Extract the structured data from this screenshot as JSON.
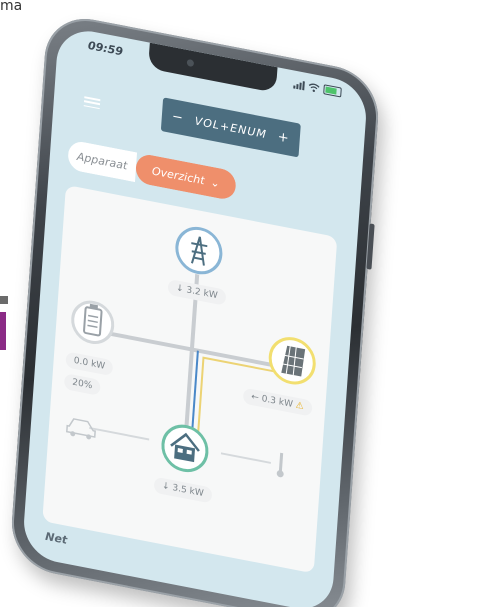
{
  "page": {
    "corner_text": "ma"
  },
  "status_bar": {
    "time": "09:59",
    "icons": [
      "signal-icon",
      "wifi-icon",
      "battery-icon"
    ]
  },
  "header": {
    "menu_icon": "hamburger-menu-icon",
    "stepper": {
      "minus": "−",
      "label": "VOL+ENUM",
      "plus": "+"
    }
  },
  "view_toggle": {
    "options": [
      "Apparaat",
      "Overzicht"
    ],
    "selected": "Overzicht",
    "chevron": "⌄"
  },
  "energy_overview": {
    "grid": {
      "icon": "power-pylon-icon",
      "value": "↓ 3.2 kW"
    },
    "battery": {
      "icon": "battery-icon",
      "value": "0.0 kW",
      "charge": "20%"
    },
    "solar": {
      "icon": "solar-panel-icon",
      "value": "← 0.3 kW",
      "warning_icon": "warning-icon"
    },
    "house": {
      "icon": "house-icon",
      "value": "↓ 3.5 kW"
    },
    "car": {
      "icon": "car-icon"
    },
    "heat": {
      "icon": "thermometer-icon"
    }
  },
  "footer": {
    "label": "Net"
  },
  "colors": {
    "screen_bg": "#d3e7ee",
    "stepper_bg": "#4c6e80",
    "toggle_active": "#ef8f6b",
    "grid_ring": "#8ab6d6",
    "solar_ring": "#f2df70",
    "house_ring": "#6ec0a6",
    "battery_line": "#4a88c8",
    "solar_line": "#ecd374",
    "brand_purple": "#8b2b86"
  }
}
